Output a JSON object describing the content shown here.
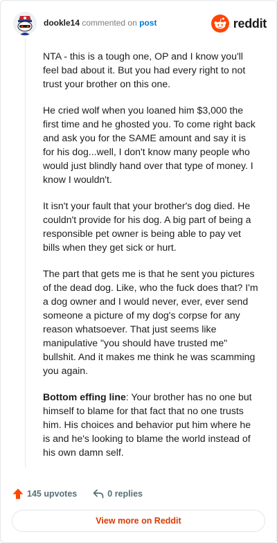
{
  "header": {
    "username": "dookle14",
    "action_text": "commented on",
    "post_link": "post",
    "brand": "reddit",
    "avatar_icon": "snoo-avatar-icon",
    "brand_icon": "reddit-logo-icon",
    "brand_color": "#ff4500"
  },
  "comment": {
    "paragraphs": [
      "NTA - this is a tough one, OP and I know you'll feel bad about it. But you had every right to not trust your brother on this one.",
      "He cried wolf when you loaned him $3,000 the first time and he ghosted you. To come right back and ask you for the SAME amount and say it is for his dog...well, I don't know many people who would just blindly hand over that type of money. I know I wouldn't.",
      "It isn't your fault that your brother's dog died. He couldn't provide for his dog. A big part of being a responsible pet owner is being able to pay vet bills when they get sick or hurt.",
      "The part that gets me is that he sent you pictures of the dead dog. Like, who the fuck does that? I'm a dog owner and I would never, ever, ever send someone a picture of my dog's corpse for any reason whatsoever. That just seems like manipulative \"you should have trusted me\" bullshit. And it makes me think he was scamming you again."
    ],
    "final_bold": "Bottom effing line",
    "final_text": ": Your brother has no one but himself to blame for that fact that no one trusts him. His choices and behavior put him where he is and he's looking to blame the world instead of his own damn self."
  },
  "actions": {
    "upvotes": "145 upvotes",
    "replies": "0 replies",
    "upvote_icon": "upvote-arrow-icon",
    "reply_icon": "reply-arrow-icon",
    "upvote_color": "#ff4500"
  },
  "view_more": {
    "label": "View more on Reddit"
  }
}
